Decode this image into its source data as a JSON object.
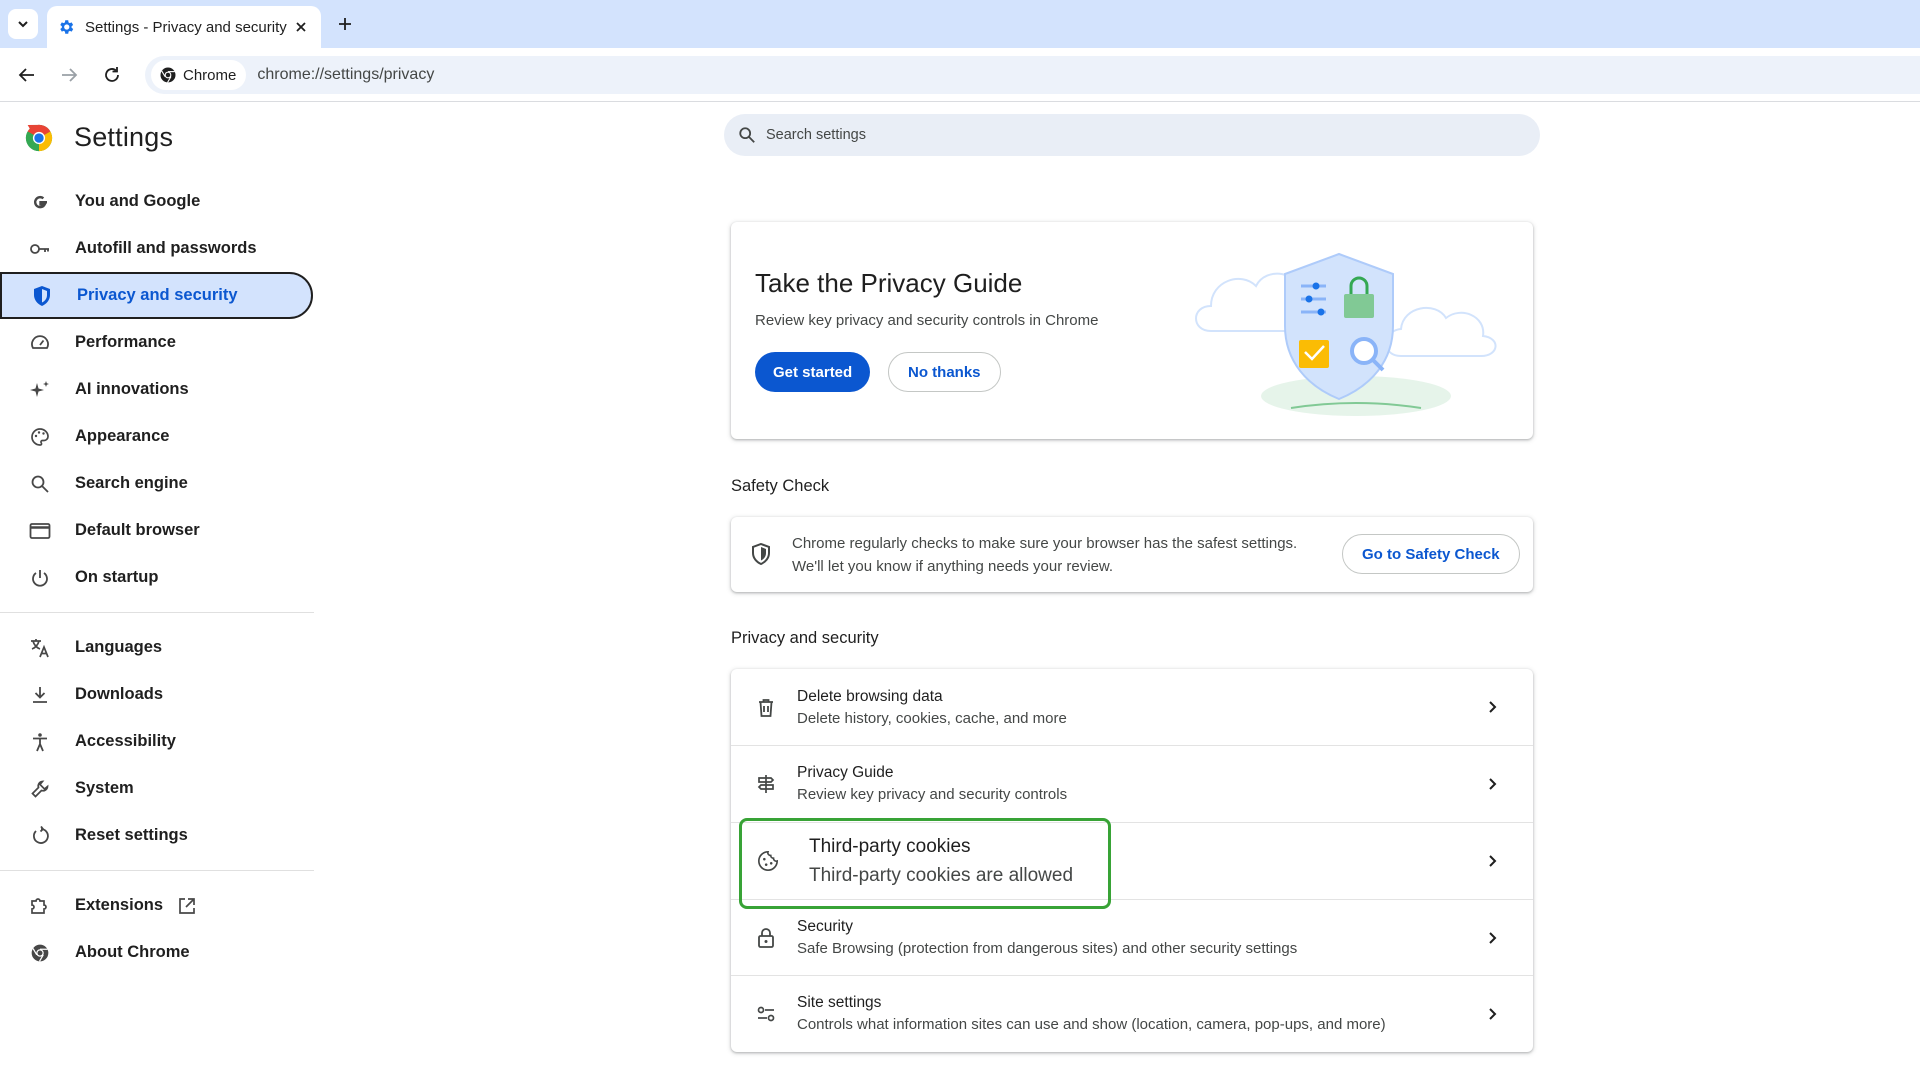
{
  "browser": {
    "tab_title": "Settings - Privacy and security",
    "omnibox_chip": "Chrome",
    "url": "chrome://settings/privacy"
  },
  "sidebar": {
    "title": "Settings",
    "items": [
      {
        "label": "You and Google",
        "icon": "google-g-icon"
      },
      {
        "label": "Autofill and passwords",
        "icon": "key-icon"
      },
      {
        "label": "Privacy and security",
        "icon": "shield-icon",
        "active": true
      },
      {
        "label": "Performance",
        "icon": "speedometer-icon"
      },
      {
        "label": "AI innovations",
        "icon": "sparkle-icon"
      },
      {
        "label": "Appearance",
        "icon": "palette-icon"
      },
      {
        "label": "Search engine",
        "icon": "search-icon"
      },
      {
        "label": "Default browser",
        "icon": "browser-window-icon"
      },
      {
        "label": "On startup",
        "icon": "power-icon"
      }
    ],
    "items2": [
      {
        "label": "Languages",
        "icon": "translate-icon"
      },
      {
        "label": "Downloads",
        "icon": "download-icon"
      },
      {
        "label": "Accessibility",
        "icon": "accessibility-icon"
      },
      {
        "label": "System",
        "icon": "wrench-icon"
      },
      {
        "label": "Reset settings",
        "icon": "reset-icon"
      }
    ],
    "items3": [
      {
        "label": "Extensions",
        "icon": "puzzle-icon"
      },
      {
        "label": "About Chrome",
        "icon": "chrome-icon"
      }
    ]
  },
  "search": {
    "placeholder": "Search settings"
  },
  "privacy_guide_card": {
    "title": "Take the Privacy Guide",
    "description": "Review key privacy and security controls in Chrome",
    "primary_button": "Get started",
    "secondary_button": "No thanks"
  },
  "safety_check": {
    "section_title": "Safety Check",
    "line1": "Chrome regularly checks to make sure your browser has the safest settings.",
    "line2": "We'll let you know if anything needs your review.",
    "button": "Go to Safety Check"
  },
  "privacy_section": {
    "section_title": "Privacy and security",
    "rows": [
      {
        "title": "Delete browsing data",
        "subtitle": "Delete history, cookies, cache, and more",
        "icon": "trash-icon"
      },
      {
        "title": "Privacy Guide",
        "subtitle": "Review key privacy and security controls",
        "icon": "signpost-icon"
      },
      {
        "title": "Third-party cookies",
        "subtitle": "Third-party cookies are allowed",
        "icon": "cookie-icon",
        "highlighted": true
      },
      {
        "title": "Security",
        "subtitle": "Safe Browsing (protection from dangerous sites) and other security settings",
        "icon": "lock-icon"
      },
      {
        "title": "Site settings",
        "subtitle": "Controls what information sites can use and show (location, camera, pop-ups, and more)",
        "icon": "tune-icon"
      }
    ]
  },
  "colors": {
    "accent": "#0b57d0",
    "active_nav_bg": "#d3e3fd",
    "tabstrip_bg": "#d3e3fd",
    "highlight_border": "#38a336"
  }
}
